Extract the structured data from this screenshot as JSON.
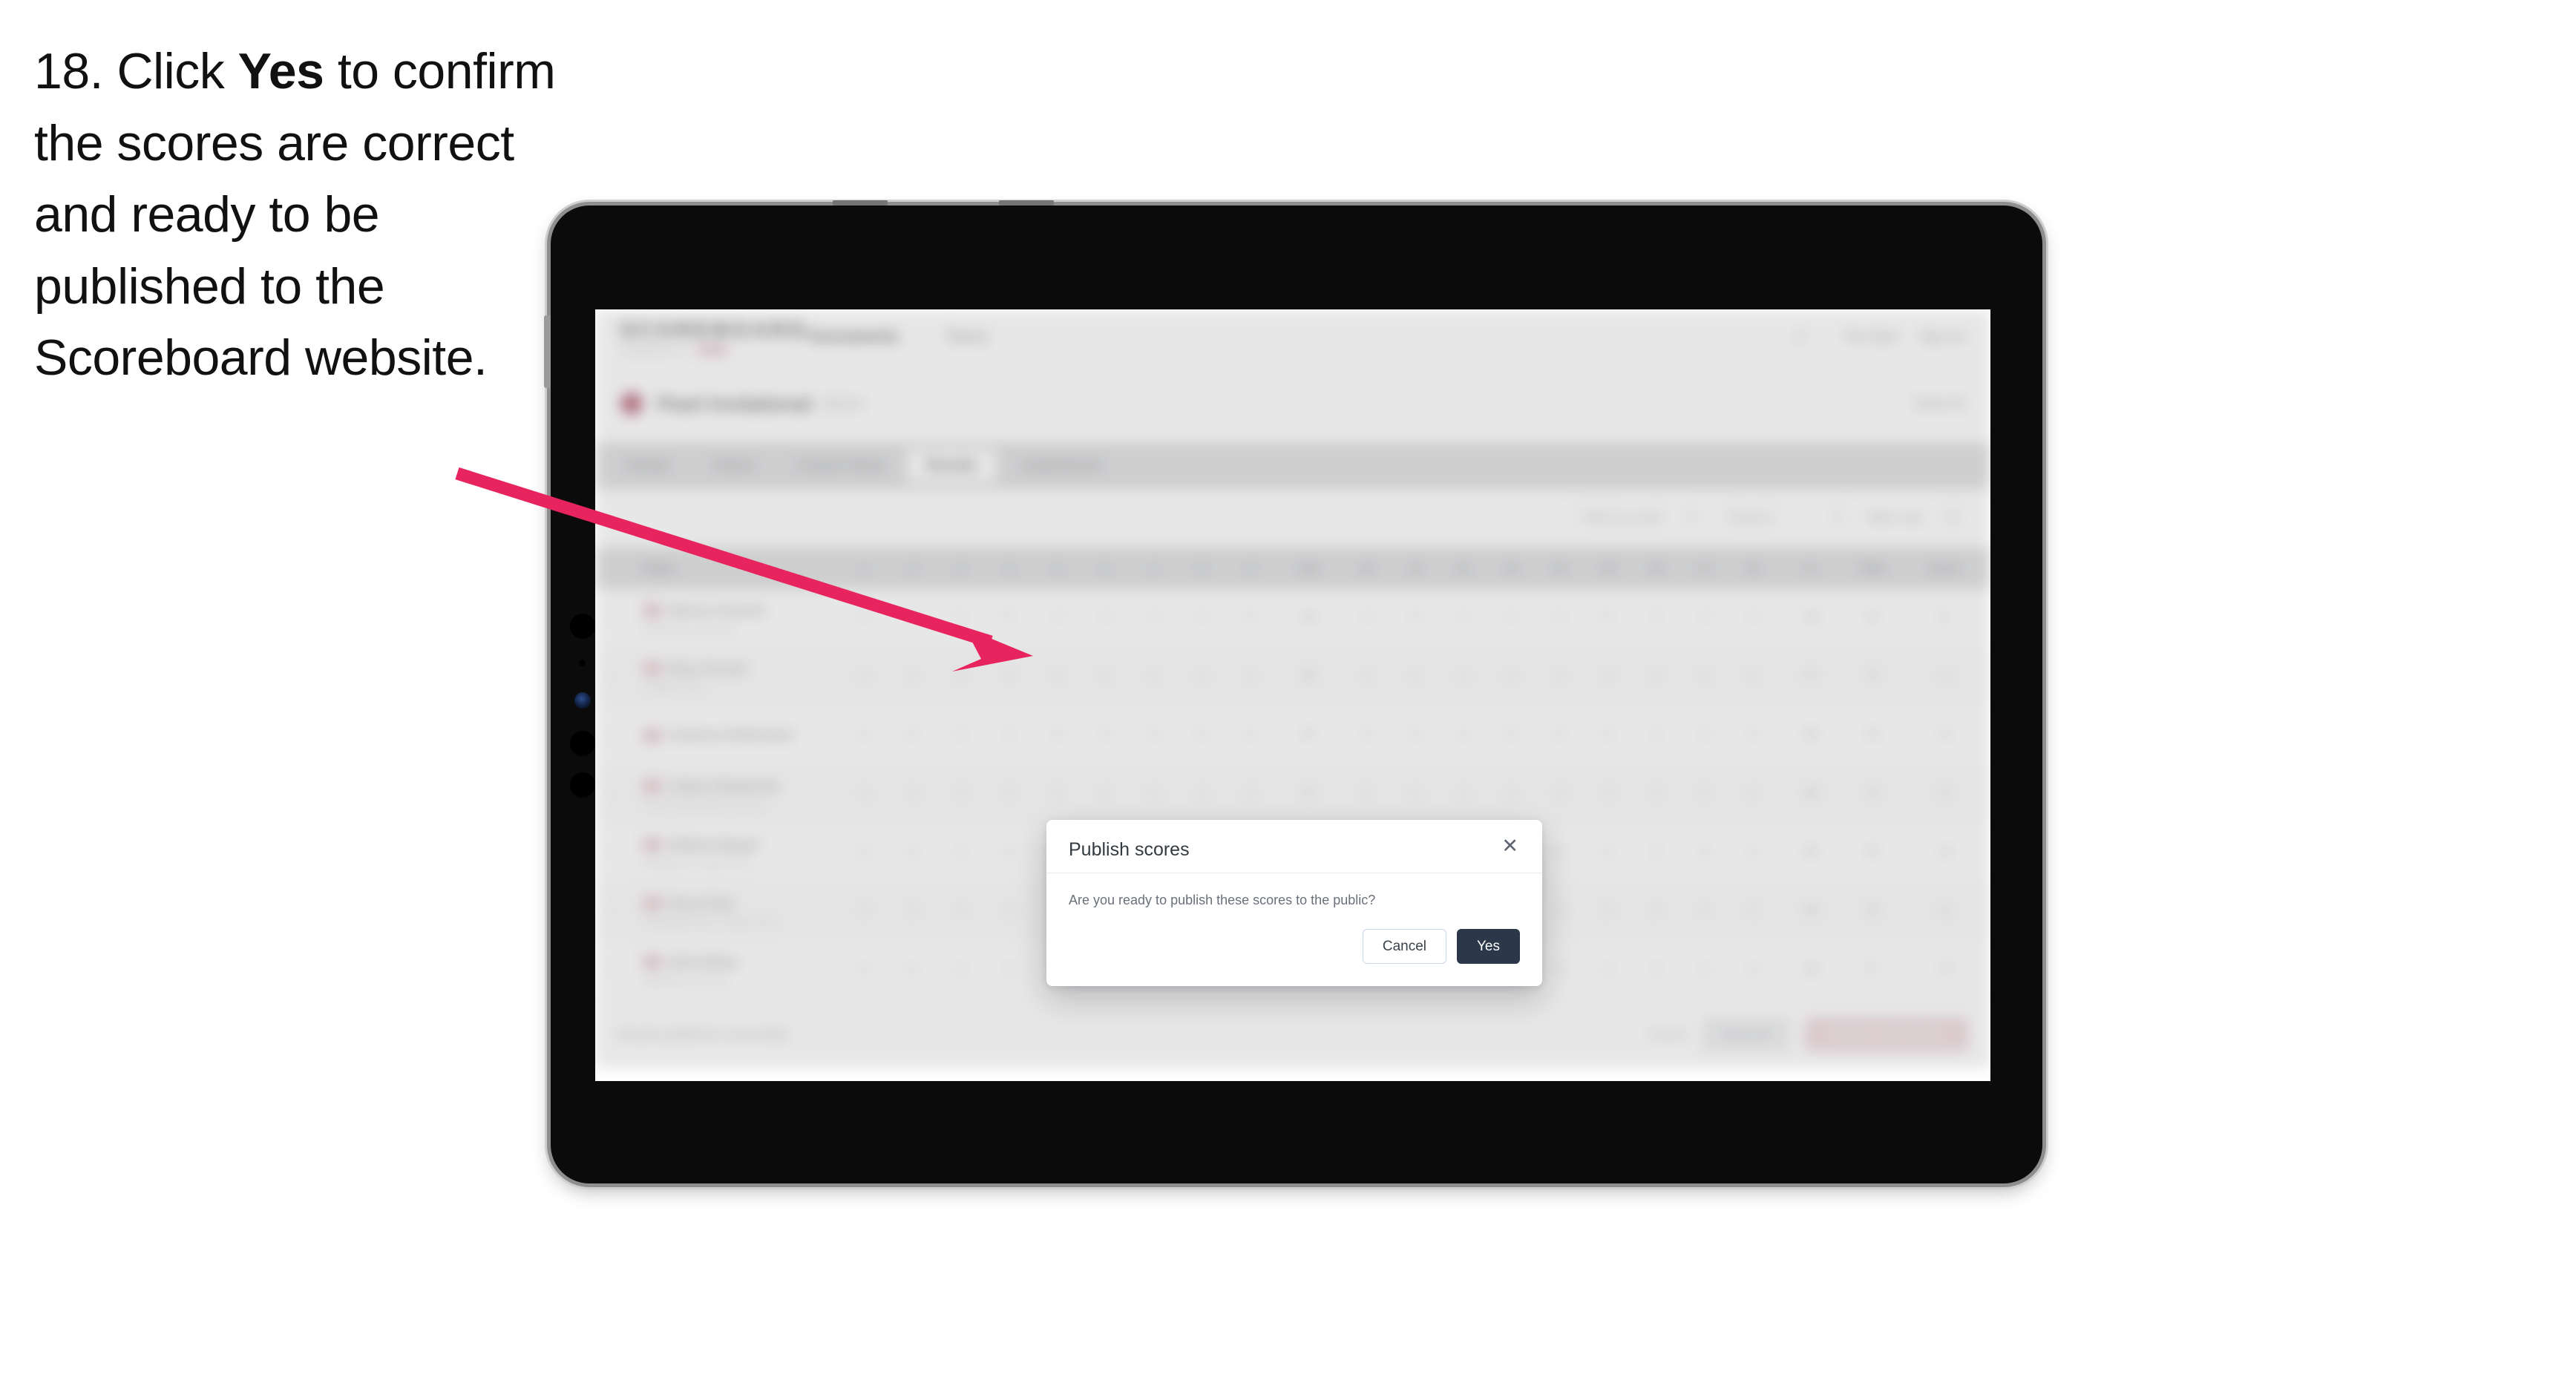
{
  "caption": {
    "number": "18.",
    "text_before": "Click",
    "emphasis": "Yes",
    "text_after": "to confirm the scores are correct and ready to be published to the Scoreboard website."
  },
  "annotation": {
    "arrow_color": "#e8245e",
    "arrow_name": "pointer-arrow-to-yes-button"
  },
  "device": {
    "type": "tablet",
    "body_color": "#0b0b0b",
    "rail_color": "#cfcfcf"
  },
  "app": {
    "header": {
      "brand": "SCOREBOARD",
      "brand_sub": "POWERED BY",
      "brand_pill": "PINK",
      "nav": [
        {
          "label": "Tournaments",
          "active": true
        },
        {
          "label": "Teams",
          "active": false
        }
      ],
      "right": [
        {
          "label": "The Open"
        },
        {
          "label": "Sign out"
        }
      ]
    },
    "title_strip": {
      "event_title": "Pearl Invitational",
      "event_sub": "2024",
      "right_label": "Event ID"
    },
    "tabs": [
      {
        "label": "Details",
        "active": false
      },
      {
        "label": "Teams",
        "active": false
      },
      {
        "label": "Course Setup",
        "active": false
      },
      {
        "label": "Results",
        "active": true
      },
      {
        "label": "Leaderboard",
        "active": false
      }
    ],
    "filters": {
      "search_placeholder": "Search",
      "filter_select": "Filter by round",
      "round_select": "Round 1",
      "view_select": "Table view",
      "settings_icon": "gear-icon"
    },
    "table": {
      "columns": [
        "Player",
        "1",
        "2",
        "3",
        "4",
        "5",
        "6",
        "7",
        "8",
        "9",
        "Out",
        "10",
        "11",
        "12",
        "13",
        "14",
        "15",
        "16",
        "17",
        "18",
        "In",
        "Total",
        "Score"
      ],
      "rows": [
        {
          "name": "Marcus Tennant",
          "sub": "Eastbourne Golf Club",
          "holes": [
            "4",
            "4",
            "3",
            "5",
            "4",
            "4",
            "3",
            "4",
            "5"
          ],
          "out": "36",
          "holes_in": [
            "4",
            "5",
            "3",
            "4",
            "4",
            "5",
            "3",
            "4",
            "4"
          ],
          "in": "36",
          "total": "72",
          "score": "E"
        },
        {
          "name": "Rhys Parnell",
          "sub": "Lowland Links",
          "holes": [
            "5",
            "4",
            "3",
            "4",
            "4",
            "5",
            "3",
            "4",
            "4"
          ],
          "out": "36",
          "holes_in": [
            "4",
            "4",
            "4",
            "5",
            "4",
            "4",
            "3",
            "4",
            "5"
          ],
          "in": "37",
          "total": "73",
          "score": "+1"
        },
        {
          "name": "Cameron Rutherford",
          "sub": "",
          "holes": [
            "4",
            "5",
            "3",
            "4",
            "5",
            "4",
            "3",
            "5",
            "4"
          ],
          "out": "37",
          "holes_in": [
            "4",
            "4",
            "3",
            "5",
            "4",
            "4",
            "4",
            "4",
            "4"
          ],
          "in": "36",
          "total": "73",
          "score": "+1"
        },
        {
          "name": "Callum Weatherby",
          "sub": "Royal Sandsprings Golf Club",
          "holes": [
            "4",
            "4",
            "4",
            "5",
            "4",
            "4",
            "3",
            "4",
            "5"
          ],
          "out": "37",
          "holes_in": [
            "5",
            "4",
            "3",
            "4",
            "5",
            "4",
            "3",
            "4",
            "4"
          ],
          "in": "36",
          "total": "74",
          "score": "+2"
        },
        {
          "name": "William Beppel",
          "sub": "Northshore Country Club",
          "holes": [
            "5",
            "4",
            "3",
            "5",
            "4",
            "5",
            "3",
            "4",
            "4"
          ],
          "out": "37",
          "holes_in": [
            "4",
            "5",
            "4",
            "4",
            "4",
            "4",
            "4",
            "5",
            "4"
          ],
          "in": "38",
          "total": "75",
          "score": "+3"
        },
        {
          "name": "Rory Kirby",
          "sub": "Castlefield Golf & Country Club",
          "holes": [
            "4",
            "5",
            "4",
            "5",
            "4",
            "4",
            "4",
            "4",
            "5"
          ],
          "out": "39",
          "holes_in": [
            "4",
            "4",
            "4",
            "5",
            "4",
            "5",
            "3",
            "4",
            "5"
          ],
          "in": "38",
          "total": "76",
          "score": "+4"
        },
        {
          "name": "Beth Bailey",
          "sub": "Highfields Golf Club",
          "holes": [
            "4",
            "4",
            "4",
            "4",
            "5",
            "4",
            "4",
            "5",
            "4"
          ],
          "out": "38",
          "holes_in": [
            "5",
            "4",
            "4",
            "4",
            "5",
            "4",
            "4",
            "4",
            "5"
          ],
          "in": "39",
          "total": "77",
          "score": "+5"
        }
      ]
    },
    "footer": {
      "note": "Results published successfully",
      "cancel_label": "Cancel",
      "save_label": "Save all",
      "publish_label": "Publish and finalise"
    }
  },
  "modal": {
    "title": "Publish scores",
    "close_icon": "close-icon",
    "message": "Are you ready to publish these scores to the public?",
    "cancel_label": "Cancel",
    "confirm_label": "Yes",
    "confirm_color": "#2c3749"
  }
}
